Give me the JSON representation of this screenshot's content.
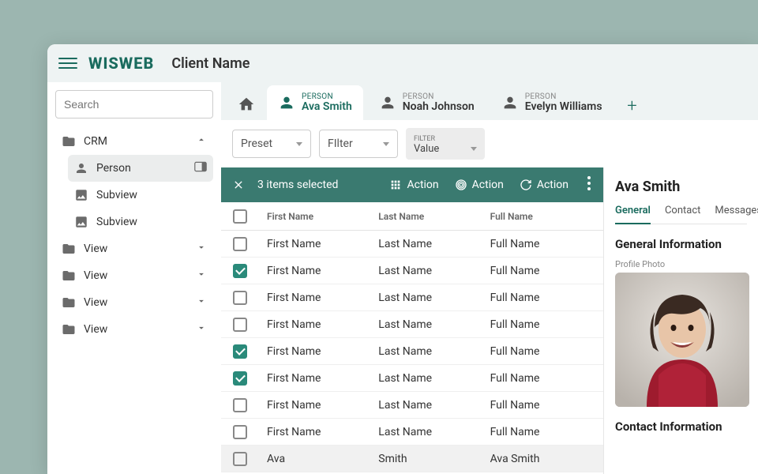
{
  "colors": {
    "accent": "#1a6b5e",
    "sel_bar": "#3a7a70",
    "page_bg": "#9cb6b0"
  },
  "header": {
    "logo": "WISWEB",
    "client": "Client Name"
  },
  "search": {
    "placeholder": "Search"
  },
  "sidebar": {
    "items": [
      {
        "icon": "folder",
        "label": "CRM",
        "expanded": true,
        "children": [
          {
            "icon": "person",
            "label": "Person",
            "selected": true,
            "open_badge": true
          },
          {
            "icon": "image",
            "label": "Subview"
          },
          {
            "icon": "image",
            "label": "Subview"
          }
        ]
      },
      {
        "icon": "folder",
        "label": "View",
        "expanded": false
      },
      {
        "icon": "folder",
        "label": "View",
        "expanded": false
      },
      {
        "icon": "folder",
        "label": "View",
        "expanded": false
      },
      {
        "icon": "folder",
        "label": "View",
        "expanded": false
      }
    ]
  },
  "tabs": [
    {
      "type": "PERSON",
      "name": "Ava Smith",
      "active": true
    },
    {
      "type": "PERSON",
      "name": "Noah Johnson",
      "active": false
    },
    {
      "type": "PERSON",
      "name": "Evelyn Williams",
      "active": false
    }
  ],
  "toolbar": {
    "preset": "Preset",
    "filter": "FIlter",
    "filter_block": {
      "label": "FILTER",
      "value": "Value"
    }
  },
  "selection_bar": {
    "count_text": "3 items selected",
    "actions": [
      "Action",
      "Action",
      "Action"
    ]
  },
  "table": {
    "columns": [
      "First Name",
      "Last Name",
      "Full Name"
    ],
    "rows": [
      {
        "checked": false,
        "first": "First Name",
        "last": "Last Name",
        "full": "Full Name"
      },
      {
        "checked": true,
        "first": "First Name",
        "last": "Last Name",
        "full": "Full Name"
      },
      {
        "checked": false,
        "first": "First Name",
        "last": "Last Name",
        "full": "Full Name"
      },
      {
        "checked": false,
        "first": "First Name",
        "last": "Last Name",
        "full": "Full Name"
      },
      {
        "checked": true,
        "first": "First Name",
        "last": "Last Name",
        "full": "Full Name"
      },
      {
        "checked": true,
        "first": "First Name",
        "last": "Last Name",
        "full": "Full Name"
      },
      {
        "checked": false,
        "first": "First Name",
        "last": "Last Name",
        "full": "Full Name"
      },
      {
        "checked": false,
        "first": "First Name",
        "last": "Last Name",
        "full": "Full Name"
      },
      {
        "checked": false,
        "first": "Ava",
        "last": "Smith",
        "full": "Ava Smith",
        "highlight": true
      }
    ]
  },
  "detail": {
    "title": "Ava Smith",
    "tabs": [
      "General",
      "Contact",
      "Messages"
    ],
    "active_tab": "General",
    "section1": "General Information",
    "profile_label": "Profile Photo",
    "section2": "Contact Information"
  }
}
